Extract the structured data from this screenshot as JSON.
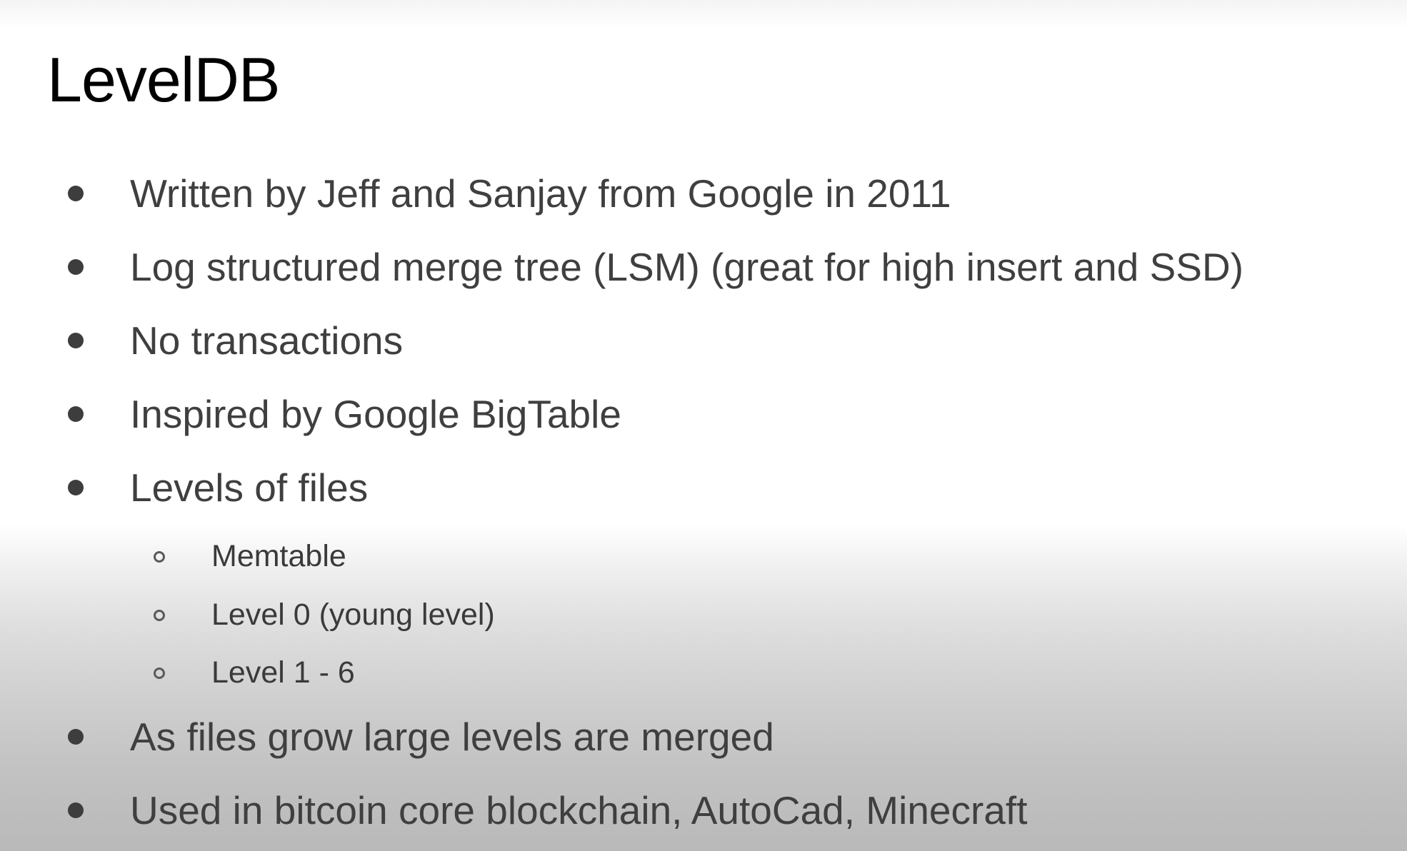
{
  "slide": {
    "title": "LevelDB",
    "bullets": [
      "Written by Jeff and Sanjay from Google in 2011",
      "Log structured merge tree (LSM) (great for high insert and SSD)",
      "No transactions",
      "Inspired by Google BigTable",
      "Levels of files"
    ],
    "sub_bullets": [
      "Memtable",
      "Level 0 (young level)",
      "Level 1 - 6"
    ],
    "bullets_after": [
      "As files grow large levels are merged",
      "Used in bitcoin core blockchain, AutoCad, Minecraft"
    ]
  }
}
